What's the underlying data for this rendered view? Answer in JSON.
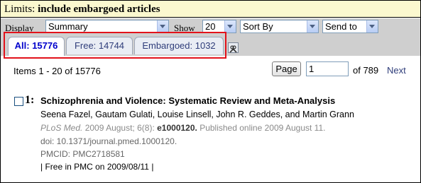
{
  "limits": {
    "label": "Limits:",
    "value": "include embargoed articles"
  },
  "toolbar": {
    "display_label": "Display",
    "display_value": "Summary",
    "show_label": "Show",
    "show_value": "20",
    "sort_value": "Sort By",
    "sendto_value": "Send to"
  },
  "tabs": [
    {
      "label": "All: 15776",
      "active": true
    },
    {
      "label": "Free: 14744",
      "active": false
    },
    {
      "label": "Embargoed: 1032",
      "active": false
    }
  ],
  "wrench_icon": "wrench-icon",
  "highlight_color": "#e2121b",
  "pager": {
    "items_text": "Items 1 - 20 of 15776",
    "page_button": "Page",
    "page_value": "1",
    "of_text": "of 789",
    "next_label": "Next"
  },
  "result": {
    "number": "1:",
    "title": "Schizophrenia and Violence: Systematic Review and Meta-Analysis",
    "authors": "Seena Fazel, Gautam Gulati, Louise Linsell, John R. Geddes, and Martin Grann",
    "journal": "PLoS Med.",
    "citation_pre": " 2009 August; 6(8): ",
    "article_id": "e1000120.",
    "citation_post": " Published online 2009 August 11.",
    "doi": "doi: 10.1371/journal.pmed.1000120.",
    "pmcid": "PMCID: PMC2718581",
    "free": "| Free in PMC on 2009/08/11 |"
  }
}
